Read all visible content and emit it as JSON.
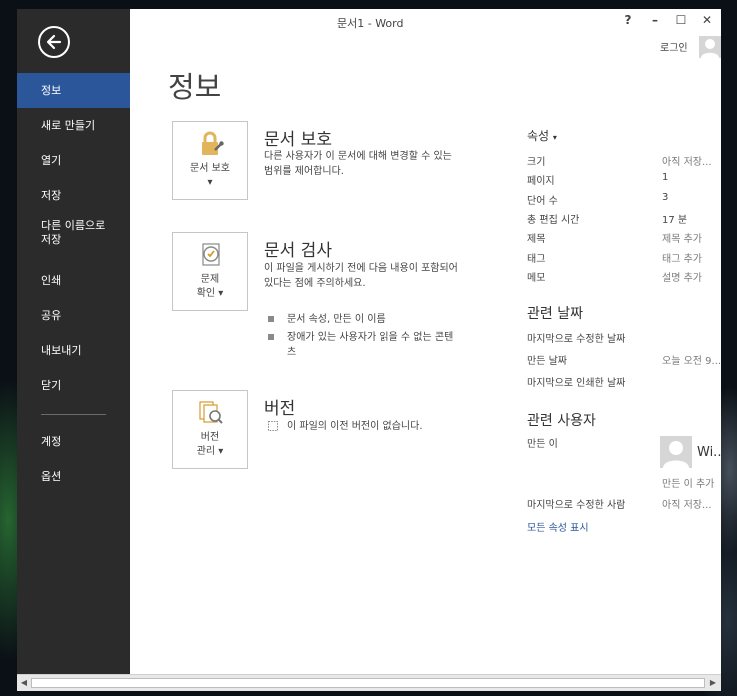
{
  "window": {
    "title": "문서1 - Word"
  },
  "titlebar": {
    "help": "?",
    "minimize": "–",
    "maximize": "☐",
    "close": "✕",
    "login": "로그인"
  },
  "sidebar": {
    "items": [
      {
        "label": "정보"
      },
      {
        "label": "새로 만들기"
      },
      {
        "label": "열기"
      },
      {
        "label": "저장"
      },
      {
        "label": "다른 이름으로 저장"
      },
      {
        "label": "인쇄"
      },
      {
        "label": "공유"
      },
      {
        "label": "내보내기"
      },
      {
        "label": "닫기"
      },
      {
        "label": "계정"
      },
      {
        "label": "옵션"
      }
    ]
  },
  "main": {
    "title": "정보",
    "protect": {
      "button": "문서 보호",
      "title": "문서 보호",
      "desc": "다른 사용자가 이 문서에 대해 변경할 수 있는 범위를 제어합니다."
    },
    "inspect": {
      "button_line1": "문제",
      "button_line2": "확인",
      "title": "문서 검사",
      "desc": "이 파일을 게시하기 전에 다음 내용이 포함되어 있다는 점에 주의하세요.",
      "bullets": [
        "문서 속성, 만든 이 이름",
        "장애가 있는 사용자가 읽을 수 없는 콘텐츠"
      ]
    },
    "versions": {
      "button_line1": "버전",
      "button_line2": "관리",
      "title": "버전",
      "desc": "이 파일의 이전 버전이 없습니다."
    }
  },
  "properties": {
    "header": "속성",
    "rows": [
      {
        "label": "크기",
        "value": "아직 저장..."
      },
      {
        "label": "페이지",
        "value": "1"
      },
      {
        "label": "단어 수",
        "value": "3"
      },
      {
        "label": "총 편집 시간",
        "value": "17 분"
      },
      {
        "label": "제목",
        "value": "제목 추가"
      },
      {
        "label": "태그",
        "value": "태그 추가"
      },
      {
        "label": "메모",
        "value": "설명 추가"
      }
    ],
    "dates_header": "관련 날짜",
    "dates": [
      {
        "label": "마지막으로 수정한 날짜",
        "value": ""
      },
      {
        "label": "만든 날짜",
        "value": "오늘 오전 9..."
      },
      {
        "label": "마지막으로 인쇄한 날짜",
        "value": ""
      }
    ],
    "people_header": "관련 사용자",
    "author_label": "만든 이",
    "author_name": "Wi...",
    "add_author": "만든 이 추가",
    "last_modified_by_label": "마지막으로 수정한 사람",
    "last_modified_by_value": "아직 저장...",
    "show_all": "모든 속성 표시"
  }
}
